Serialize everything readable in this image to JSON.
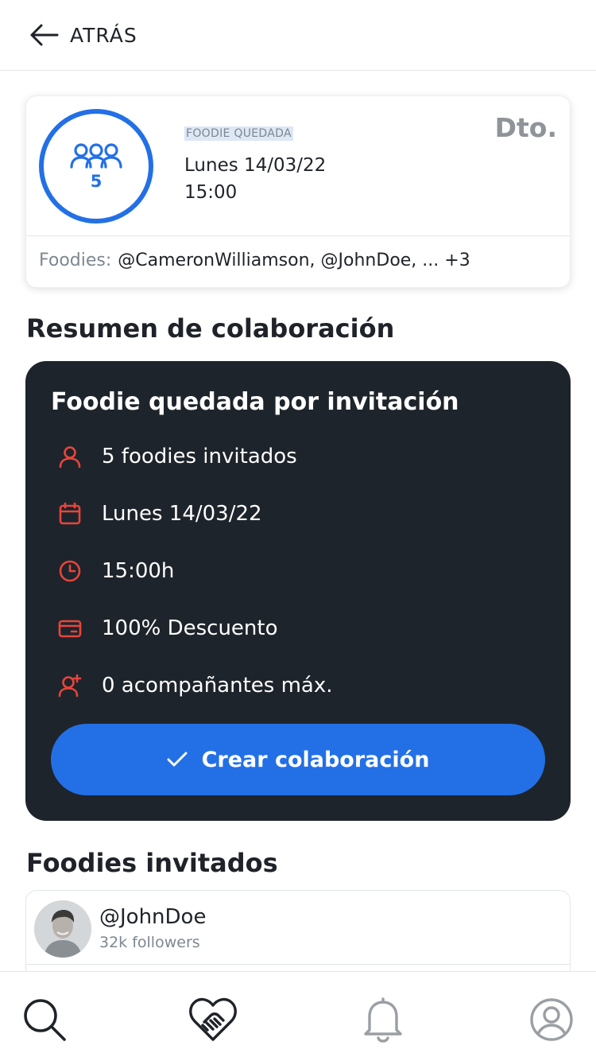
{
  "header": {
    "back_label": "ATRÁS"
  },
  "event": {
    "participants_count": "5",
    "type": "FOODIE QUEDADA",
    "date": "Lunes 14/03/22",
    "time": "15:00",
    "discount_badge": "Dto.",
    "foodies_label": "Foodies:",
    "foodies_value": "@CameronWilliamson, @JohnDoe, ... +3"
  },
  "summary": {
    "section_title": "Resumen de colaboración",
    "card_title": "Foodie quedada por invitación",
    "rows": [
      {
        "icon": "user-icon",
        "text": "5 foodies invitados"
      },
      {
        "icon": "calendar-icon",
        "text": "Lunes 14/03/22"
      },
      {
        "icon": "clock-icon",
        "text": "15:00h"
      },
      {
        "icon": "card-icon",
        "text": "100% Descuento"
      },
      {
        "icon": "user-plus-icon",
        "text": "0 acompañantes máx."
      }
    ],
    "create_button": "Crear colaboración"
  },
  "invited": {
    "section_title": "Foodies invitados",
    "items": [
      {
        "username": "@JohnDoe",
        "followers": "32k followers"
      }
    ]
  },
  "nav": {
    "items": [
      {
        "icon": "search-icon"
      },
      {
        "icon": "handshake-heart-icon",
        "active": true
      },
      {
        "icon": "bell-icon"
      },
      {
        "icon": "profile-icon"
      }
    ]
  },
  "colors": {
    "accent": "#2370e6",
    "dark_card": "#1e242b",
    "icon_red": "#e8453c"
  }
}
